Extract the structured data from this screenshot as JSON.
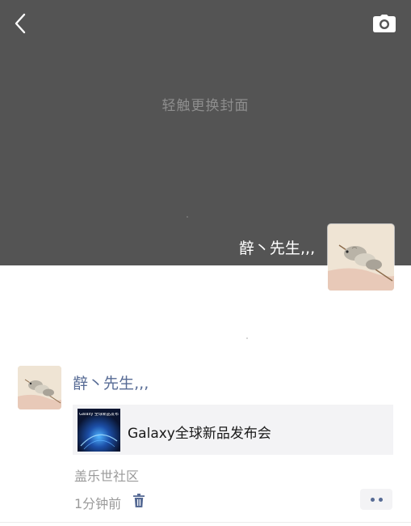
{
  "cover": {
    "hint": "轻触更换封面",
    "background_color": "#545454",
    "back_icon": "chevron-left-icon",
    "camera_icon": "camera-icon"
  },
  "profile": {
    "name": "辪丶先生‚‚‚",
    "avatar_icon": "hamster-avatar-image"
  },
  "post": {
    "author": "辪丶先生‚‚‚",
    "link_card": {
      "title": "Galaxy全球新品发布会",
      "thumbnail_text": "Galaxy 全球新品发布会"
    },
    "location": "盖乐世社区",
    "time": "1分钟前",
    "delete_icon": "trash-icon",
    "more_icon": "more-dots-icon"
  },
  "colors": {
    "link_blue": "#576b95",
    "secondary_text": "#9a9a9a",
    "card_bg": "#f3f3f5"
  }
}
